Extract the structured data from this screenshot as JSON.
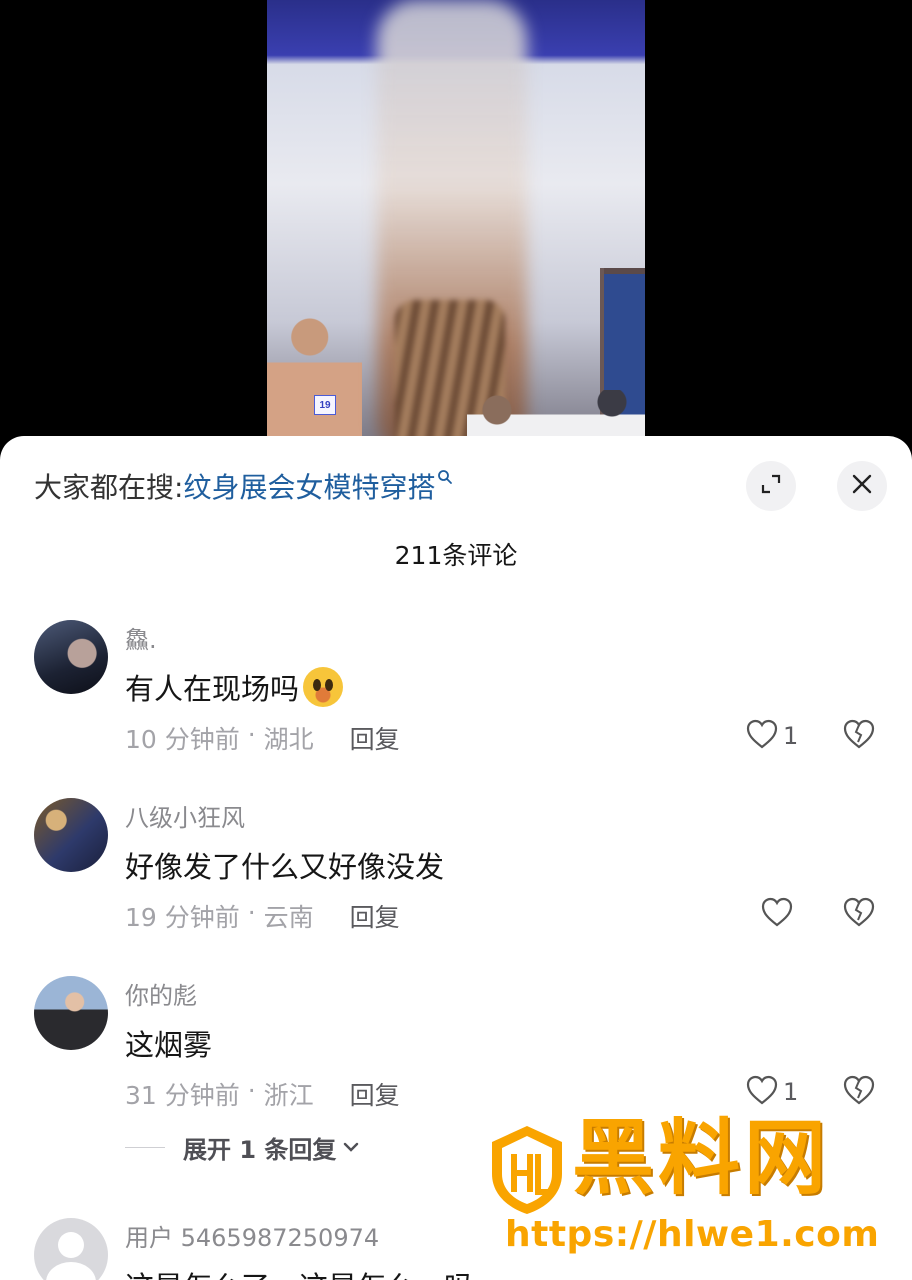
{
  "search": {
    "label": "大家都在搜:",
    "term": "纹身展会女模特穿搭",
    "icon": "search-icon"
  },
  "header": {
    "comment_count": "211条评论",
    "expand_icon": "expand-icon",
    "close_icon": "close-icon"
  },
  "video": {
    "badge_number": "19"
  },
  "comments": [
    {
      "username": "鱻.",
      "text": "有人在现场吗",
      "emoji": "crying-face",
      "time": "10 分钟前",
      "location": "湖北",
      "reply_label": "回复",
      "likes": "1"
    },
    {
      "username": "八级小狂风",
      "text": "好像发了什么又好像没发",
      "time": "19 分钟前",
      "location": "云南",
      "reply_label": "回复",
      "likes": ""
    },
    {
      "username": "你的彪",
      "text": "这烟雾",
      "time": "31 分钟前",
      "location": "浙江",
      "reply_label": "回复",
      "likes": "1",
      "expand_replies": "展开 1 条回复"
    },
    {
      "username": "用户 5465987250974",
      "text": "这是怎么了，这是怎么一吗"
    }
  ],
  "watermark": {
    "title": "黑料网",
    "url": "https://hlwe1.com",
    "logo": "hl-shield-logo"
  },
  "colors": {
    "link": "#1f5e9e",
    "watermark": "#f9a400",
    "meta": "#a3a3a8"
  }
}
